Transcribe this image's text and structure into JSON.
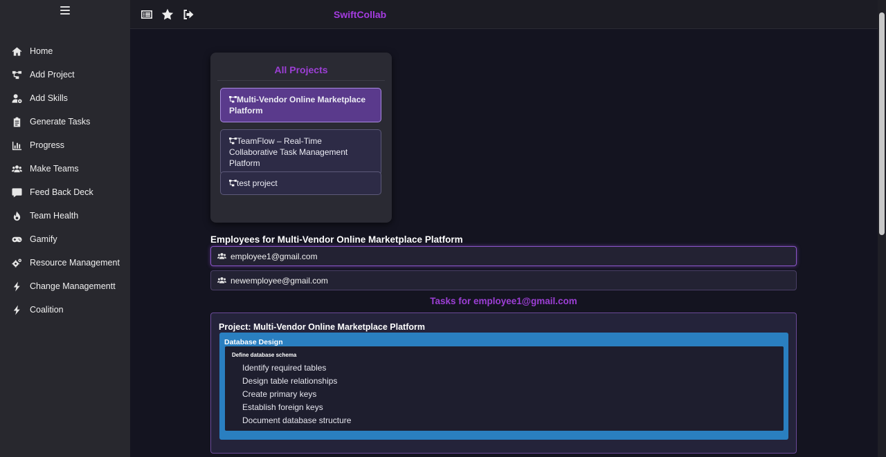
{
  "app": {
    "brand": "SwiftCollab"
  },
  "sidebar": {
    "items": [
      {
        "label": "Home",
        "icon": "home-icon"
      },
      {
        "label": "Add Project",
        "icon": "project-diagram-icon"
      },
      {
        "label": "Add Skills",
        "icon": "user-cog-icon"
      },
      {
        "label": "Generate Tasks",
        "icon": "clipboard-list-icon"
      },
      {
        "label": "Progress",
        "icon": "bar-chart-icon"
      },
      {
        "label": "Make Teams",
        "icon": "users-icon"
      },
      {
        "label": "Feed Back Deck",
        "icon": "comment-icon"
      },
      {
        "label": "Team Health",
        "icon": "fire-icon"
      },
      {
        "label": "Gamify",
        "icon": "gamepad-icon"
      },
      {
        "label": "Resource Management",
        "icon": "cogs-icon"
      },
      {
        "label": "Change Managementt",
        "icon": "bolt-icon"
      },
      {
        "label": "Coalition",
        "icon": "bolt-icon"
      }
    ]
  },
  "topbar": {
    "icons": [
      "list-alt-icon",
      "star-icon",
      "sign-out-icon"
    ]
  },
  "projects": {
    "title": "All Projects",
    "items": [
      {
        "label": "Multi-Vendor Online Marketplace Platform",
        "active": true
      },
      {
        "label": "TeamFlow – Real-Time Collaborative Task Management Platform",
        "active": false
      },
      {
        "label": "test project",
        "active": false
      }
    ]
  },
  "employees": {
    "heading": "Employees for Multi-Vendor Online Marketplace Platform",
    "items": [
      {
        "email": "employee1@gmail.com",
        "active": true
      },
      {
        "email": "newemployee@gmail.com",
        "active": false
      }
    ]
  },
  "tasks": {
    "heading": "Tasks for employee1@gmail.com",
    "project_title": "Project: Multi-Vendor Online Marketplace Platform",
    "task": {
      "title": "Database Design",
      "subtask": {
        "title": "Define database schema",
        "items": [
          "Identify required tables",
          "Design table relationships",
          "Create primary keys",
          "Establish foreign keys",
          "Document database structure"
        ]
      }
    }
  },
  "colors": {
    "accent": "#9d3fd6",
    "brand": "#a53ce0",
    "task_box": "#2a7fc0",
    "active_project": "#5a3a8c"
  }
}
